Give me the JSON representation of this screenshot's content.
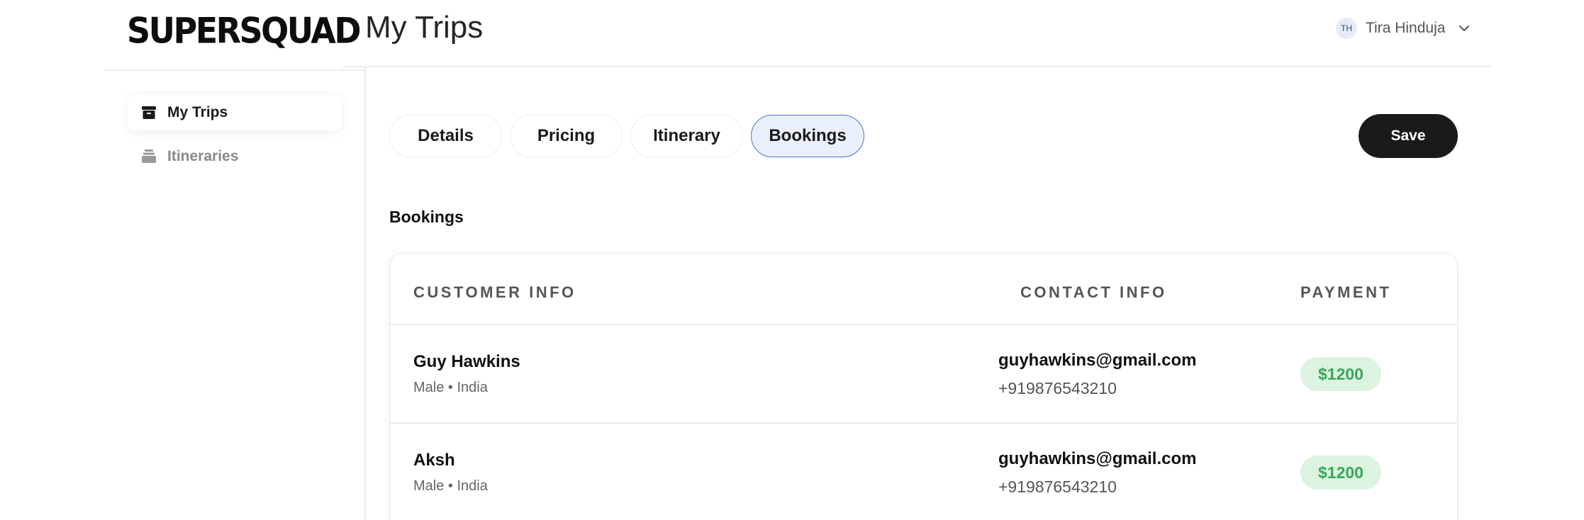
{
  "app": {
    "logo_text": "SUPERSQUAD",
    "page_title": "My Trips"
  },
  "user": {
    "initials": "TH",
    "name": "Tira Hinduja"
  },
  "sidebar": {
    "items": [
      {
        "label": "My Trips",
        "icon": "archive-box-icon",
        "active": true
      },
      {
        "label": "Itineraries",
        "icon": "stack-icon",
        "active": false
      }
    ]
  },
  "tabs": [
    {
      "label": "Details",
      "active": false
    },
    {
      "label": "Pricing",
      "active": false
    },
    {
      "label": "Itinerary",
      "active": false
    },
    {
      "label": "Bookings",
      "active": true
    }
  ],
  "toolbar": {
    "save_label": "Save"
  },
  "bookings": {
    "section_title": "Bookings",
    "columns": [
      "CUSTOMER INFO",
      "CONTACT INFO",
      "PAYMENT"
    ],
    "rows": [
      {
        "name": "Guy Hawkins",
        "meta": "Male • India",
        "email": "guyhawkins@gmail.com",
        "phone": "+919876543210",
        "payment": "$1200"
      },
      {
        "name": "Aksh",
        "meta": "Male • India",
        "email": "guyhawkins@gmail.com",
        "phone": "+919876543210",
        "payment": "$1200"
      }
    ]
  },
  "colors": {
    "accent": "#4a74c9",
    "tab_active_bg": "#e9f0fb",
    "payment_bg": "#dcf3e1",
    "payment_text": "#3aa55a",
    "button_dark": "#1a1a1a"
  }
}
